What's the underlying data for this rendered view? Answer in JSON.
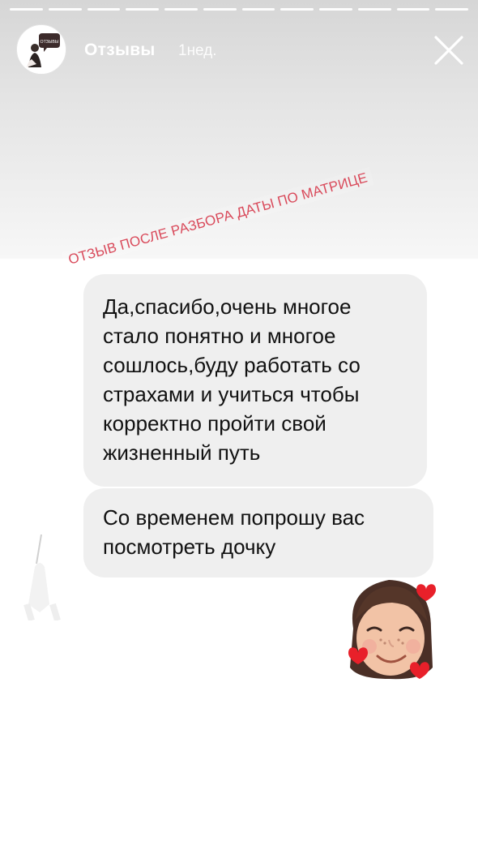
{
  "story": {
    "progress_segments": 12,
    "header": {
      "author": "Отзывы",
      "time_ago": "1нед."
    },
    "avatar": {
      "badge_text": "ОТЗЫВЫ"
    },
    "sticker": {
      "text": "ОТЗЫВ ПОСЛЕ РАЗБОРА ДАТЫ ПО МАТРИЦЕ",
      "color": "#d9495a"
    },
    "messages": [
      {
        "lines": [
          "Да,спасибо,очень многое",
          "стало понятно и многое",
          "сошлось,буду работать со",
          "страхами и учиться чтобы",
          "корректно  пройти свой",
          "жизненный путь"
        ]
      },
      {
        "lines": [
          "Со временем попрошу вас",
          "посмотреть дочку"
        ]
      }
    ],
    "colors": {
      "bubble": "#efefef",
      "text": "#111111"
    }
  }
}
